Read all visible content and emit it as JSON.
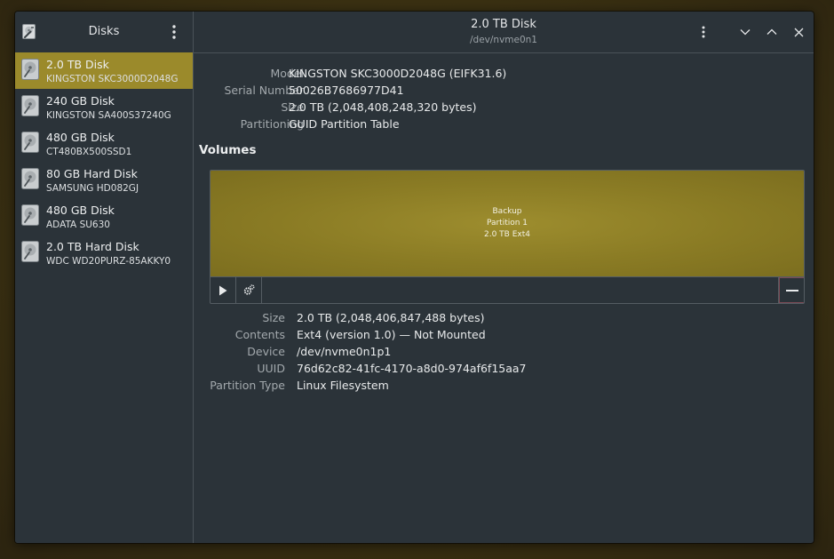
{
  "sidebar": {
    "title": "Disks",
    "app_icon": "disk-utility-icon",
    "menu_icon": "kebab-menu-icon",
    "disks": [
      {
        "name": "2.0 TB Disk",
        "model": "KINGSTON SKC3000D2048G",
        "selected": true
      },
      {
        "name": "240 GB Disk",
        "model": "KINGSTON SA400S37240G",
        "selected": false
      },
      {
        "name": "480 GB Disk",
        "model": "CT480BX500SSD1",
        "selected": false
      },
      {
        "name": "80 GB Hard Disk",
        "model": "SAMSUNG HD082GJ",
        "selected": false
      },
      {
        "name": "480 GB Disk",
        "model": "ADATA SU630",
        "selected": false
      },
      {
        "name": "2.0 TB Hard Disk",
        "model": "WDC WD20PURZ-85AKKY0",
        "selected": false
      }
    ]
  },
  "header": {
    "title": "2.0 TB Disk",
    "subtitle": "/dev/nvme0n1",
    "icons": [
      "kebab-menu-icon",
      "minimize-icon",
      "maximize-icon",
      "close-icon"
    ]
  },
  "disk_info": {
    "rows": [
      {
        "label": "Model",
        "value": "KINGSTON SKC3000D2048G (EIFK31.6)"
      },
      {
        "label": "Serial Number",
        "value": "50026B7686977D41"
      },
      {
        "label": "Size",
        "value": "2.0 TB (2,048,408,248,320 bytes)"
      },
      {
        "label": "Partitioning",
        "value": "GUID Partition Table"
      }
    ]
  },
  "volumes": {
    "title": "Volumes",
    "partition": {
      "line1": "Backup",
      "line2": "Partition 1",
      "line3": "2.0 TB Ext4"
    },
    "toolbar_icons": [
      "play-icon",
      "gears-icon",
      "minus-icon"
    ]
  },
  "partition_info": {
    "rows": [
      {
        "label": "Size",
        "value": "2.0 TB (2,048,406,847,488 bytes)"
      },
      {
        "label": "Contents",
        "value": "Ext4 (version 1.0) — Not Mounted"
      },
      {
        "label": "Device",
        "value": "/dev/nvme0n1p1"
      },
      {
        "label": "UUID",
        "value": "76d62c82-41fc-4170-a8d0-974af6f15aa7"
      },
      {
        "label": "Partition Type",
        "value": "Linux Filesystem"
      }
    ]
  },
  "colors": {
    "selection": "#9b8a2b",
    "partition": "#8f8027",
    "window_bg": "#2b3339"
  }
}
